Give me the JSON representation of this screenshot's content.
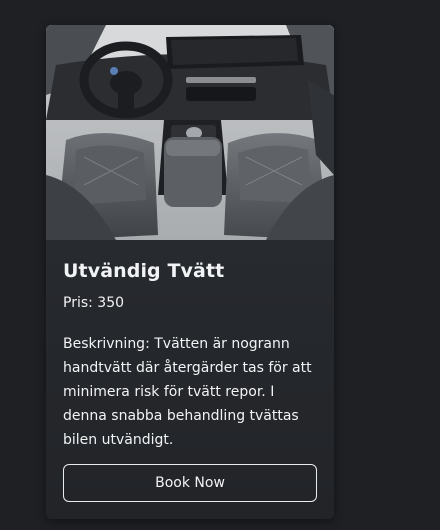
{
  "card": {
    "image_subject": "car-interior",
    "title": "Utvändig Tvätt",
    "price": "Pris: 350",
    "description": "Beskrivning: Tvätten är nogrann handtvätt där återgärder tas för att minimera risk för tvätt repor. I denna snabba behandling tvättas bilen utvändigt.",
    "button_label": "Book Now"
  },
  "colors": {
    "page_background": "#1e2024",
    "card_background": "#2a2d31",
    "text": "#f2f3f5",
    "button_border": "#e9ecef"
  }
}
